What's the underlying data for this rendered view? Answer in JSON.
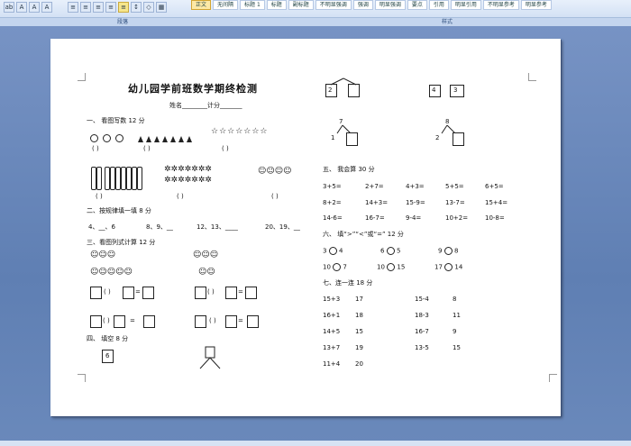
{
  "ribbon": {
    "group_labels": [
      "段落",
      "样式"
    ],
    "styles": [
      "正文",
      "无间隔",
      "标题 1",
      "标题",
      "副标题",
      "不明显强调",
      "强调",
      "明显强调",
      "要点",
      "引用",
      "明显引用",
      "不明显参考",
      "明显参考"
    ]
  },
  "doc": {
    "title": "幼儿园学前班数学期终检测",
    "name_line": "姓名________计分_______",
    "s1": "一、   看图写数   12 分",
    "paren": "(    )",
    "s2": "二、按规律填一填        8 分",
    "seq": [
      "4、__、6",
      "8、9、__",
      "12、13、____",
      "20、19、__"
    ],
    "s3": "三、看图列式计算   12 分",
    "ops": [
      "(  )",
      "=",
      "(  )",
      "="
    ],
    "s4": "四、   填空   8 分",
    "n6": "6",
    "tree_top": [
      "2",
      "4",
      "3"
    ],
    "tree_mid": [
      {
        "top": "7",
        "left": "1"
      },
      {
        "top": "8",
        "left": "2"
      }
    ],
    "s5": "五、   我会算   30 分",
    "calc": [
      [
        "3+5=",
        "2+7=",
        "4+3=",
        "5+5=",
        "6+5="
      ],
      [
        "8+2=",
        "14+3=",
        "15-9=",
        "13-7=",
        "15+4="
      ],
      [
        "14-6=",
        "16-7=",
        "9-4=",
        "10+2=",
        "10-8="
      ]
    ],
    "s6": "六、   填“>”“<”或“=”  12 分",
    "cmp": [
      [
        "3",
        "4"
      ],
      [
        "6",
        "5"
      ],
      [
        "9",
        "8"
      ],
      [
        "10",
        "7"
      ],
      [
        "10",
        "15"
      ],
      [
        "17",
        "14"
      ]
    ],
    "s7": "七、连一连     18 分",
    "match": [
      [
        "15+3",
        "17",
        "15-4",
        "8"
      ],
      [
        "16+1",
        "18",
        "18-3",
        "11"
      ],
      [
        "14+5",
        "15",
        "16-7",
        "9"
      ],
      [
        "13+7",
        "19",
        "13-5",
        "15"
      ],
      [
        "11+4",
        "20",
        "",
        ""
      ]
    ]
  }
}
